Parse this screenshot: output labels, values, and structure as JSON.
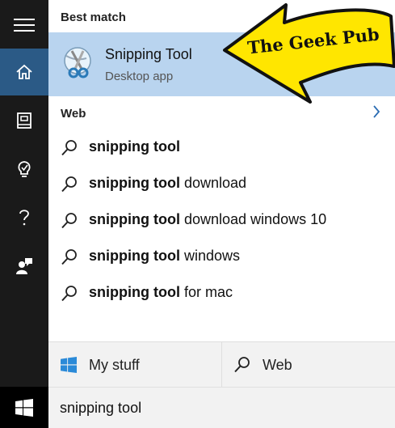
{
  "rail": {
    "items": [
      {
        "name": "menu",
        "icon": "hamburger-icon"
      },
      {
        "name": "home",
        "icon": "home-icon",
        "active": true
      },
      {
        "name": "notebook",
        "icon": "notebook-icon"
      },
      {
        "name": "reminders",
        "icon": "lightbulb-icon"
      },
      {
        "name": "help",
        "icon": "question-icon"
      },
      {
        "name": "feedback",
        "icon": "feedback-icon"
      }
    ],
    "start_icon": "windows-logo-icon",
    "accent": "#2b5a86"
  },
  "best_match": {
    "heading": "Best match",
    "app_name": "Snipping Tool",
    "app_type": "Desktop app",
    "icon": "scissors-icon",
    "highlight": "#b9d4ef"
  },
  "web": {
    "heading": "Web",
    "suggestions": [
      {
        "bold": "snipping tool",
        "rest": ""
      },
      {
        "bold": "snipping tool",
        "rest": " download"
      },
      {
        "bold": "snipping tool",
        "rest": " download windows 10"
      },
      {
        "bold": "snipping tool",
        "rest": " windows"
      },
      {
        "bold": "snipping tool",
        "rest": " for mac"
      }
    ]
  },
  "filters": {
    "my_stuff": "My stuff",
    "web": "Web"
  },
  "search": {
    "value": "snipping tool"
  },
  "watermark": {
    "text": "The Geek Pub",
    "color": "#ffe600"
  }
}
